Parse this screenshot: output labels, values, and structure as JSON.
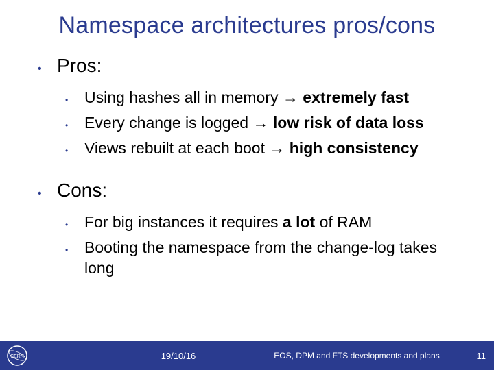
{
  "title": "Namespace architectures pros/cons",
  "sections": [
    {
      "heading": "Pros:",
      "items": [
        {
          "pre": "Using hashes all in memory ",
          "arrow": "→",
          "boldTail": " extremely fast"
        },
        {
          "pre": "Every change is logged ",
          "arrow": "→",
          "boldTail": " low risk of data loss"
        },
        {
          "pre": "Views rebuilt at each boot ",
          "arrow": "→",
          "boldTail": " high consistency"
        }
      ]
    },
    {
      "heading": "Cons:",
      "items": [
        {
          "pre": "For big instances it requires ",
          "boldMid": "a lot",
          "post": " of RAM"
        },
        {
          "pre": "Booting the namespace from the change-log takes long"
        }
      ]
    }
  ],
  "footer": {
    "logoText": "CERN",
    "date": "19/10/16",
    "title": "EOS, DPM and FTS developments and plans",
    "page": "11"
  }
}
